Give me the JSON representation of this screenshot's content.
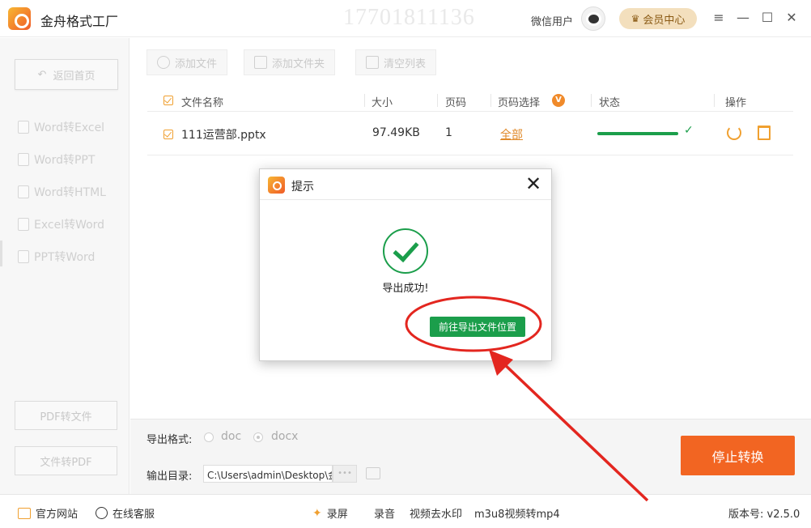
{
  "app": {
    "title": "金舟格式工厂",
    "watermark": "17701811136",
    "wechat_user": "微信用户",
    "vip_label": "会员中心",
    "window_controls": [
      "≡",
      "—",
      "☐",
      "✕"
    ]
  },
  "sidebar": {
    "back_label": "返回首页",
    "items": [
      {
        "label": "Word转Excel"
      },
      {
        "label": "Word转PPT"
      },
      {
        "label": "Word转HTML"
      },
      {
        "label": "Excel转Word"
      },
      {
        "label": "PPT转Word"
      }
    ],
    "pdf_to_file": "PDF转文件",
    "file_to_pdf": "文件转PDF"
  },
  "toolbar": {
    "add_file": "添加文件",
    "add_folder": "添加文件夹",
    "clear_list": "清空列表"
  },
  "table": {
    "headers": {
      "name": "文件名称",
      "size": "大小",
      "pages": "页码",
      "page_select": "页码选择",
      "page_select_badge": "V",
      "status": "状态",
      "actions": "操作"
    },
    "rows": [
      {
        "name": "111运营部.pptx",
        "size": "97.49KB",
        "pages": "1",
        "page_select": "全部",
        "progress": 1.0
      }
    ]
  },
  "export": {
    "format_label": "导出格式:",
    "formats": [
      "doc",
      "docx"
    ],
    "selected_format": "docx",
    "dir_label": "输出目录:",
    "dir_value": "C:\\Users\\admin\\Desktop\\金",
    "dots": "•••",
    "stop_label": "停止转换"
  },
  "statusbar": {
    "website": "官方网站",
    "support": "在线客服",
    "record_screen": "录屏",
    "record_audio": "录音",
    "remove_watermark": "视频去水印",
    "m3u8": "m3u8视频转mp4",
    "version": "版本号: v2.5.0"
  },
  "dialog": {
    "title": "提示",
    "close": "✕",
    "message": "导出成功!",
    "goto_button": "前往导出文件位置"
  },
  "colors": {
    "accent_orange": "#f26522",
    "success_green": "#1b9e4b",
    "annotation_red": "#e3261f"
  }
}
